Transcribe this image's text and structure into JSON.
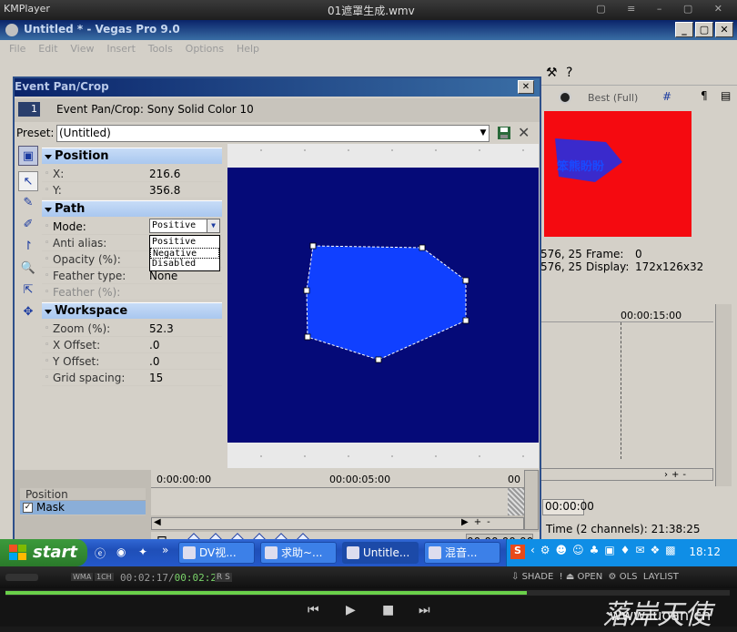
{
  "kmplayer": {
    "brand": "KMPlayer",
    "window_title": "01遮罩生成.wmv",
    "time_elapsed": "00:02:17",
    "time_total": "00:02:26",
    "codec_badges": [
      "WMA",
      "1CH"
    ],
    "rs_badge": "R S",
    "shade_label": "SHADE",
    "open_label": "OPEN",
    "tools_label": "OLS",
    "playlist_label": "LAYLIST",
    "seek_fraction": 0.72
  },
  "vegas": {
    "title": "Untitled * - Vegas Pro 9.0",
    "menu": [
      "File",
      "Edit",
      "View",
      "Insert",
      "Tools",
      "Options",
      "Help"
    ],
    "preview": {
      "quality_label": "Best (Full)",
      "overlay_text": "笨熊盼盼",
      "frame_label": "Frame:",
      "frame_value": "0",
      "display_label": "Display:",
      "display_value": "172x126x32",
      "coord1": "576, 25",
      "coord2": "576, 25",
      "red": "#f50a10",
      "shape_blue": "#3a2acc"
    },
    "timeline_right": {
      "time_marker": "00:00:15:00",
      "time_field": "00:00:00",
      "status": "Time (2 channels): 21:38:25"
    }
  },
  "dialog": {
    "title": "Event Pan/Crop",
    "event_number": "1",
    "event_label": "Event Pan/Crop: Sony Solid Color 10",
    "preset_label": "Preset:",
    "preset_value": "(Untitled)",
    "groups": {
      "position": {
        "label": "Position",
        "rows": [
          {
            "key": "X:",
            "value": "216.6"
          },
          {
            "key": "Y:",
            "value": "356.8"
          }
        ]
      },
      "path": {
        "label": "Path",
        "mode_key": "Mode:",
        "mode_value": "Positive",
        "mode_options": [
          "Positive",
          "Negative",
          "Disabled"
        ],
        "rows": [
          {
            "key": "Anti alias:",
            "value": ""
          },
          {
            "key": "Opacity (%):",
            "value": ""
          },
          {
            "key": "Feather type:",
            "value": "None"
          },
          {
            "key": "Feather (%):",
            "value": ""
          }
        ]
      },
      "workspace": {
        "label": "Workspace",
        "rows": [
          {
            "key": "Zoom (%):",
            "value": "52.3"
          },
          {
            "key": "X Offset:",
            "value": ".0"
          },
          {
            "key": "Y Offset:",
            "value": ".0"
          },
          {
            "key": "Grid spacing:",
            "value": "15"
          }
        ]
      }
    },
    "canvas_blue": "#050a78",
    "mask_blue": "#1040ff",
    "tracks": {
      "position": "Position",
      "mask": "Mask"
    },
    "timeline": {
      "t0": "0:00:00:00",
      "t1": "00:00:05:00",
      "t2": "00",
      "current_time": "00:00:00:00"
    }
  },
  "taskbar": {
    "start_label": "start",
    "buttons": [
      "DV视...",
      "求助~...",
      "Untitle...",
      "混音..."
    ],
    "clock": "18:12"
  },
  "watermark": {
    "cn": "落岸天使",
    "url": "www.luoan.cn"
  }
}
